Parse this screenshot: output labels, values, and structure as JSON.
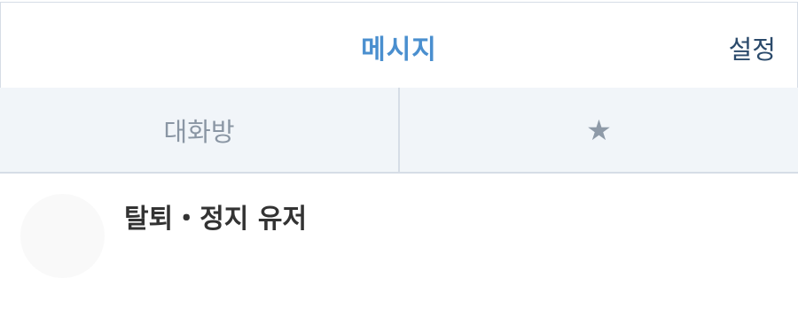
{
  "header": {
    "title": "메시지",
    "settings_label": "설정"
  },
  "tabs": [
    {
      "label": "대화방"
    },
    {
      "label": "★",
      "icon": "star-icon"
    }
  ],
  "conversations": [
    {
      "name": "탈퇴・정지 유저"
    }
  ]
}
